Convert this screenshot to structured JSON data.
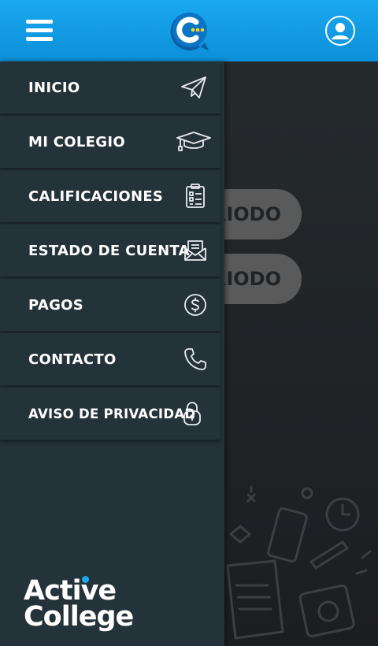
{
  "header": {
    "menu_icon": "hamburger-menu-icon",
    "logo_icon": "chat-bubble-c-logo",
    "profile_icon": "user-avatar-icon",
    "accent_color": "#1aa9ef"
  },
  "background": {
    "period_buttons": [
      "RIODO",
      "RIODO"
    ]
  },
  "drawer": {
    "items": [
      {
        "label": "INICIO",
        "icon": "paper-plane-icon"
      },
      {
        "label": "MI COLEGIO",
        "icon": "graduation-cap-icon"
      },
      {
        "label": "CALIFICACIONES",
        "icon": "clipboard-checklist-icon"
      },
      {
        "label": "ESTADO DE CUENTA",
        "icon": "envelope-letter-icon"
      },
      {
        "label": "PAGOS",
        "icon": "dollar-coin-icon"
      },
      {
        "label": "CONTACTO",
        "icon": "phone-icon"
      },
      {
        "label": "AVISO DE PRIVACIDAD",
        "icon": "padlock-icon"
      }
    ],
    "brand": {
      "line1": "Active",
      "line2": "College"
    }
  }
}
